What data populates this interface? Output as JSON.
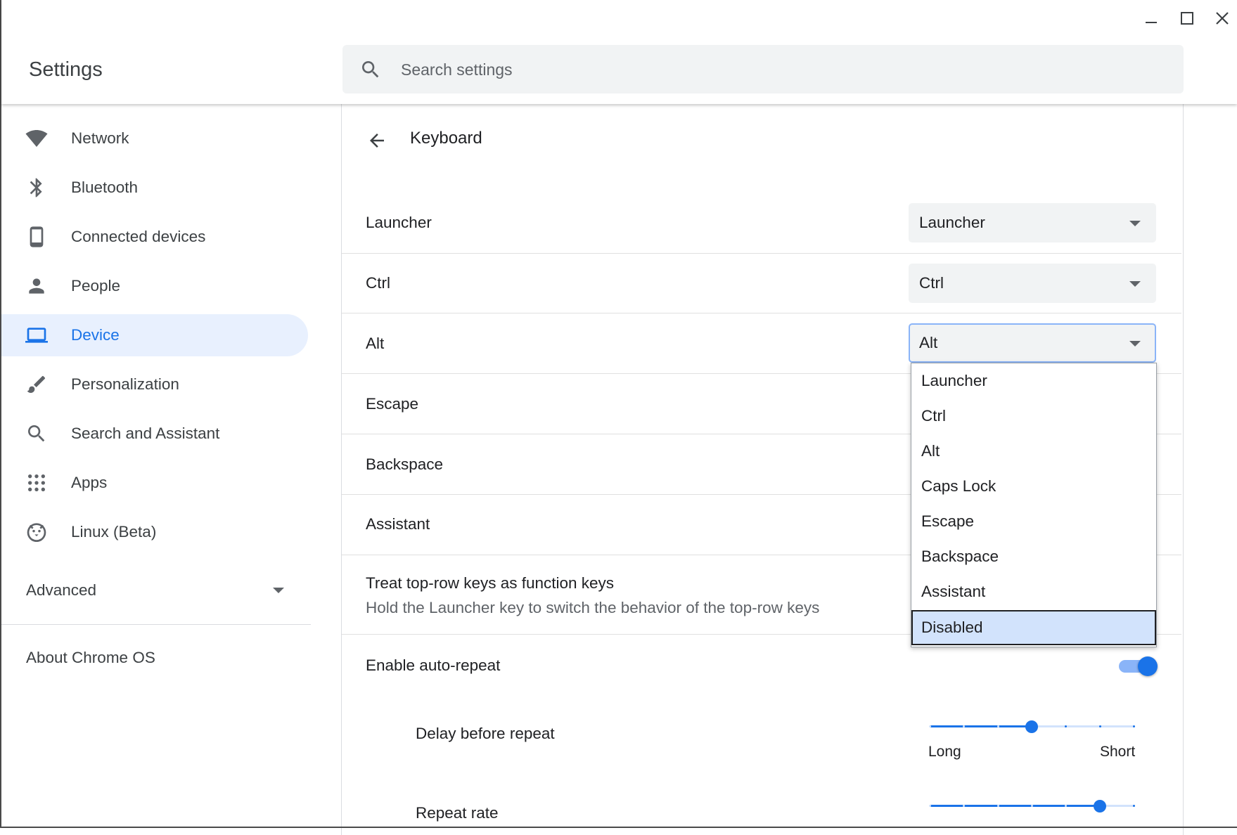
{
  "window": {
    "controls": [
      "minimize-icon",
      "maximize-icon",
      "close-icon"
    ]
  },
  "header": {
    "title": "Settings",
    "search": {
      "placeholder": "Search settings",
      "value": ""
    }
  },
  "sidebar": {
    "items": [
      {
        "label": "Network",
        "icon": "wifi-icon"
      },
      {
        "label": "Bluetooth",
        "icon": "bluetooth-icon"
      },
      {
        "label": "Connected devices",
        "icon": "phone-icon"
      },
      {
        "label": "People",
        "icon": "person-icon"
      },
      {
        "label": "Device",
        "icon": "laptop-icon",
        "selected": true
      },
      {
        "label": "Personalization",
        "icon": "brush-icon"
      },
      {
        "label": "Search and Assistant",
        "icon": "search-icon"
      },
      {
        "label": "Apps",
        "icon": "apps-grid-icon"
      },
      {
        "label": "Linux (Beta)",
        "icon": "penguin-icon"
      }
    ],
    "advanced_label": "Advanced",
    "about_label": "About Chrome OS"
  },
  "main": {
    "page_title": "Keyboard",
    "rows": [
      {
        "label": "Launcher",
        "select_value": "Launcher"
      },
      {
        "label": "Ctrl",
        "select_value": "Ctrl"
      },
      {
        "label": "Alt",
        "select_value": "Alt"
      },
      {
        "label": "Escape"
      },
      {
        "label": "Backspace"
      },
      {
        "label": "Assistant"
      }
    ],
    "function_keys": {
      "label": "Treat top-row keys as function keys",
      "sublabel": "Hold the Launcher key to switch the behavior of the top-row keys"
    },
    "auto_repeat": {
      "label": "Enable auto-repeat",
      "enabled": true
    },
    "delay": {
      "label": "Delay before repeat",
      "min_label": "Long",
      "max_label": "Short",
      "steps": 7,
      "value_index": 3
    },
    "repeat_rate": {
      "label": "Repeat rate",
      "steps": 7,
      "value_index": 5
    }
  },
  "dropdown": {
    "options": [
      "Launcher",
      "Ctrl",
      "Alt",
      "Caps Lock",
      "Escape",
      "Backspace",
      "Assistant",
      "Disabled"
    ],
    "highlighted": "Disabled"
  },
  "colors": {
    "accent": "#1a73e8",
    "selected_bg": "#e8f0fe",
    "highlight_bg": "#d2e3fc"
  }
}
